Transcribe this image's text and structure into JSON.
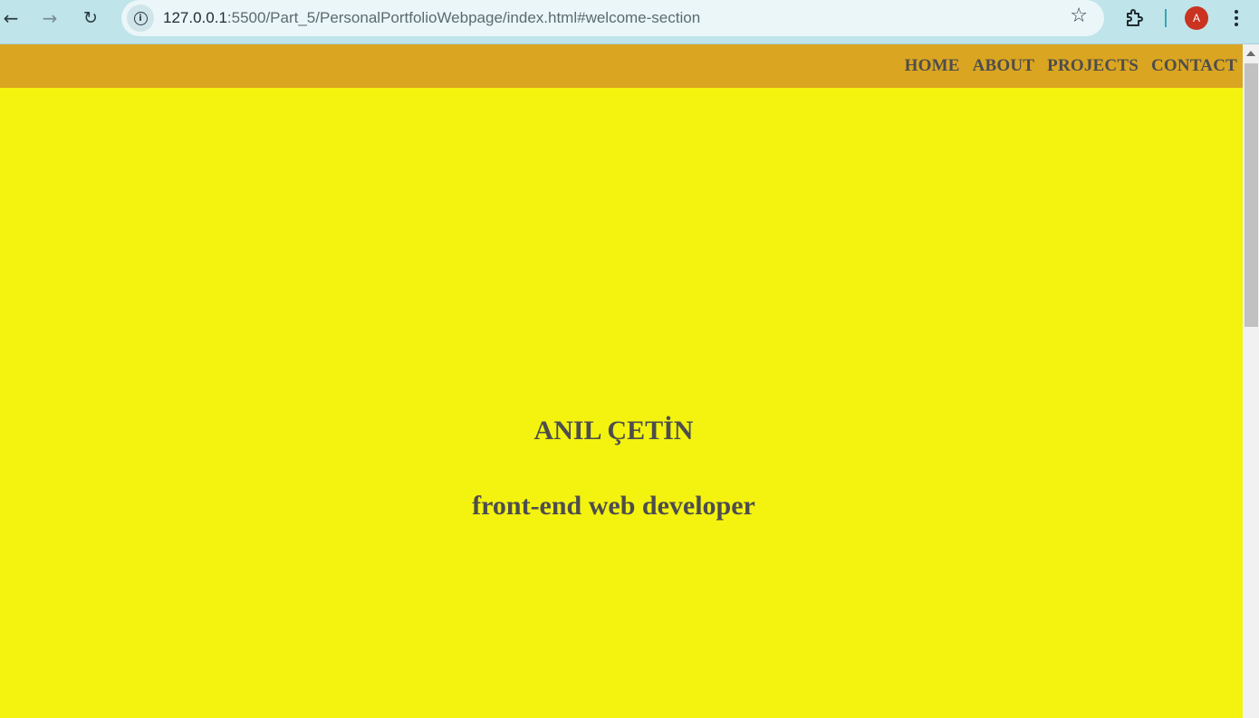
{
  "browser": {
    "url_host": "127.0.0.1",
    "url_rest": ":5500/Part_5/PersonalPortfolioWebpage/index.html#welcome-section",
    "profile_initial": "A",
    "icons": {
      "back": "arrow-left-icon",
      "forward": "arrow-right-icon",
      "reload": "reload-icon",
      "site_info": "info-icon",
      "bookmark": "star-icon",
      "extensions": "puzzle-icon",
      "menu": "kebab-menu-icon"
    }
  },
  "nav": {
    "links": [
      "HOME",
      "ABOUT",
      "PROJECTS",
      "CONTACT"
    ]
  },
  "welcome": {
    "name": "ANIL ÇETİN",
    "subtitle": "front-end web developer"
  },
  "colors": {
    "nav_background": "#daa520",
    "welcome_background": "#f3f30f",
    "text": "#4d4d4d",
    "chrome_background": "#bfe4ea",
    "avatar": "#c9331f"
  }
}
